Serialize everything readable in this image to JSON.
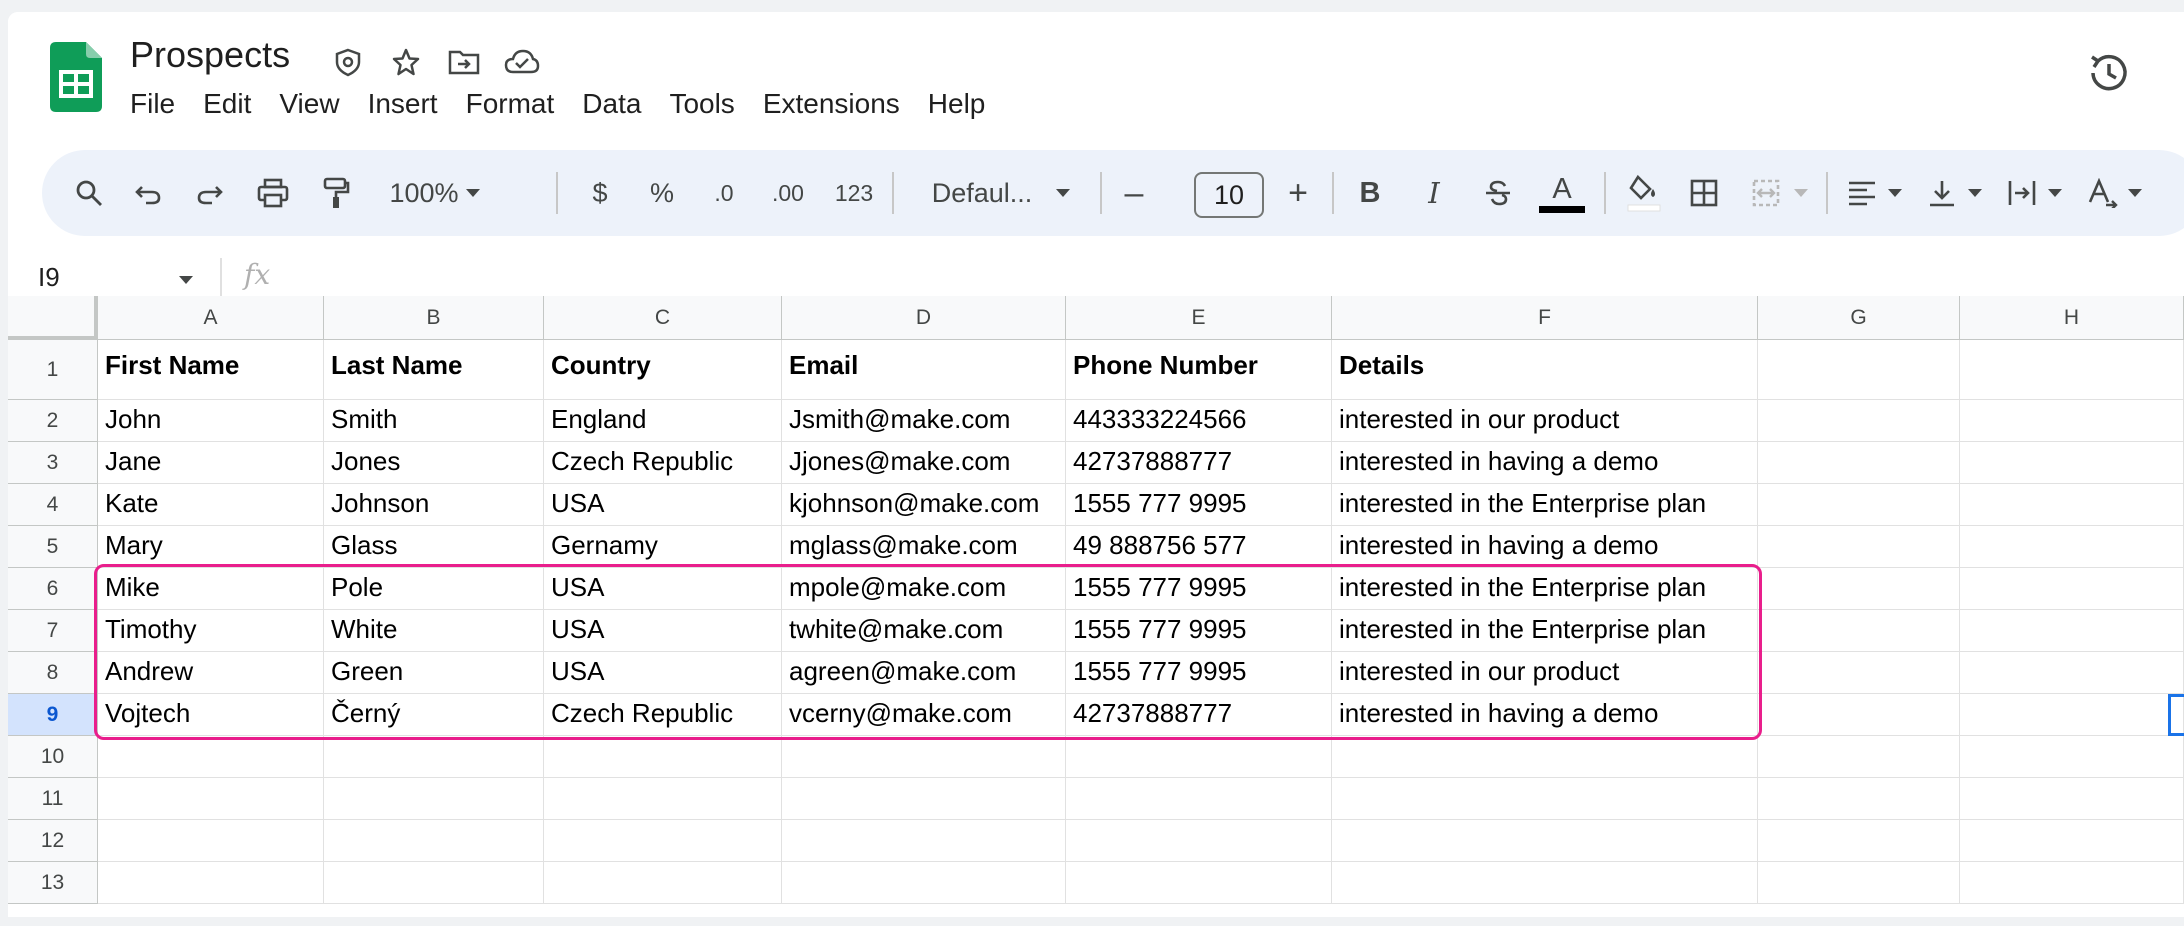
{
  "app": {
    "title": "Prospects",
    "menu": [
      "File",
      "Edit",
      "View",
      "Insert",
      "Format",
      "Data",
      "Tools",
      "Extensions",
      "Help"
    ],
    "title_icons": [
      "security-icon",
      "star-icon",
      "move-folder-icon",
      "cloud-status-icon"
    ],
    "history_icon": "version-history-icon",
    "brand_color": "#0f9d58"
  },
  "toolbar": {
    "zoom": "100%",
    "currency": "$",
    "percent": "%",
    "decrease_decimal": ".0",
    "increase_decimal": ".00",
    "number_format": "123",
    "font": "Defaul...",
    "font_size": "10",
    "minus": "–",
    "plus": "+",
    "bold": "B",
    "italic": "I",
    "text_color": "A"
  },
  "formula_bar": {
    "cell_ref": "I9",
    "fx": "fx",
    "value": ""
  },
  "sheet": {
    "columns": [
      "A",
      "B",
      "C",
      "D",
      "E",
      "F",
      "G",
      "H"
    ],
    "row_numbers": [
      "1",
      "2",
      "3",
      "4",
      "5",
      "6",
      "7",
      "8",
      "9",
      "10",
      "11",
      "12",
      "13"
    ],
    "selected_row": "9",
    "headers": [
      "First Name",
      "Last Name",
      "Country",
      "Email",
      "Phone Number",
      "Details"
    ],
    "rows": [
      [
        "John",
        "Smith",
        "England",
        "Jsmith@make.com",
        "443333224566",
        "interested in our product"
      ],
      [
        "Jane",
        "Jones",
        "Czech Republic",
        "Jjones@make.com",
        "42737888777",
        "interested in having a demo"
      ],
      [
        "Kate",
        "Johnson",
        "USA",
        "kjohnson@make.com",
        "1555 777 9995",
        "interested in the Enterprise plan"
      ],
      [
        "Mary",
        "Glass",
        "Gernamy",
        "mglass@make.com",
        "49 888756 577",
        "interested in having a demo"
      ],
      [
        "Mike",
        "Pole",
        "USA",
        "mpole@make.com",
        "1555 777 9995",
        "interested in the Enterprise plan"
      ],
      [
        "Timothy",
        "White",
        "USA",
        "twhite@make.com",
        "1555 777 9995",
        "interested in the Enterprise plan"
      ],
      [
        "Andrew",
        "Green",
        "USA",
        "agreen@make.com",
        "1555 777 9995",
        "interested in our product"
      ],
      [
        "Vojtech",
        "Černý",
        "Czech Republic",
        "vcerny@make.com",
        "42737888777",
        "interested in having a demo"
      ]
    ],
    "highlight_color": "#e91e8c"
  }
}
